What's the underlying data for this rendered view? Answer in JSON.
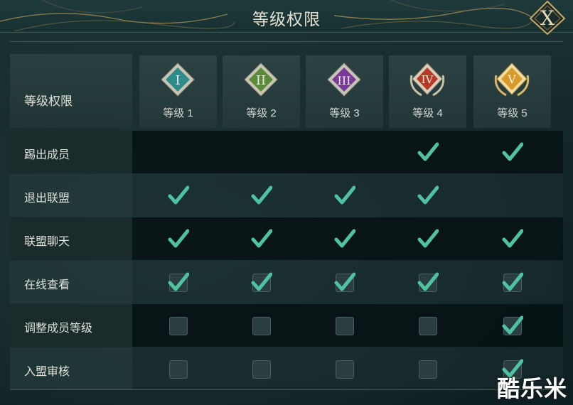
{
  "header": {
    "title": "等级权限"
  },
  "close_button": {
    "glyph": "X",
    "icon": "close-icon"
  },
  "table": {
    "corner_label": "等级权限",
    "levels": [
      {
        "numeral": "I",
        "label": "等级 1",
        "badge_color": "#2f8a8a",
        "icon": "level-1-diamond-icon"
      },
      {
        "numeral": "II",
        "label": "等级 2",
        "badge_color": "#5a8a3a",
        "icon": "level-2-diamond-icon"
      },
      {
        "numeral": "III",
        "label": "等级 3",
        "badge_color": "#7a3a9a",
        "icon": "level-3-diamond-icon"
      },
      {
        "numeral": "IV",
        "label": "等级 4",
        "badge_color": "#b83a2a",
        "icon": "level-4-laurel-badge-icon"
      },
      {
        "numeral": "V",
        "label": "等级 5",
        "badge_color": "#d89a2a",
        "icon": "level-5-laurel-badge-icon"
      }
    ],
    "rows": [
      {
        "label": "踢出成员",
        "cells": [
          "none",
          "none",
          "none",
          "check",
          "check"
        ]
      },
      {
        "label": "退出联盟",
        "cells": [
          "check",
          "check",
          "check",
          "check",
          "none"
        ]
      },
      {
        "label": "联盟聊天",
        "cells": [
          "check",
          "check",
          "check",
          "check",
          "check"
        ]
      },
      {
        "label": "在线查看",
        "cells": [
          "checkbox-checked",
          "checkbox-checked",
          "checkbox-checked",
          "checkbox-checked",
          "checkbox-checked"
        ]
      },
      {
        "label": "调整成员等级",
        "cells": [
          "checkbox",
          "checkbox",
          "checkbox",
          "checkbox",
          "checkbox-checked"
        ]
      },
      {
        "label": "入盟审核",
        "cells": [
          "checkbox",
          "checkbox",
          "checkbox",
          "checkbox",
          "checkbox-checked"
        ]
      }
    ]
  },
  "watermark": {
    "text": "酷乐米"
  },
  "colors": {
    "check": "#4fc2a0",
    "gold": "#c8a865"
  }
}
